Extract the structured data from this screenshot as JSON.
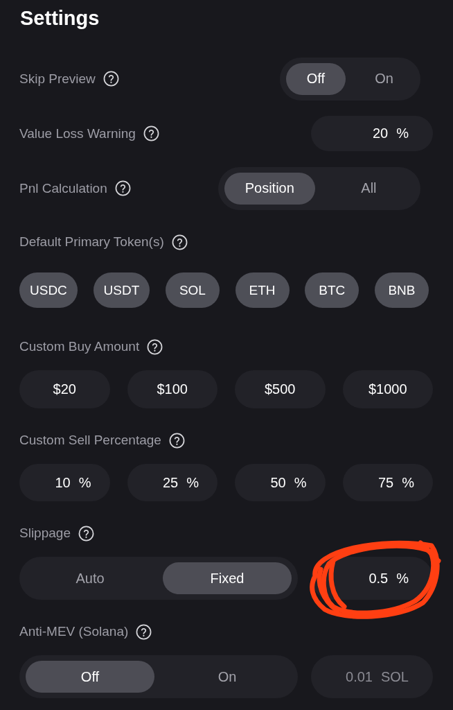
{
  "title": "Settings",
  "settings": [
    {
      "kind": "segmented",
      "label": "Skip Preview",
      "options": [
        {
          "label": "Off",
          "selected": true
        },
        {
          "label": "On",
          "selected": false
        }
      ]
    },
    {
      "kind": "input",
      "label": "Value Loss Warning",
      "field": {
        "value": "20",
        "unit": "%",
        "disabled": false
      }
    },
    {
      "kind": "segmented",
      "label": "Pnl Calculation",
      "options": [
        {
          "label": "Position",
          "selected": true
        },
        {
          "label": "All",
          "selected": false
        }
      ]
    },
    {
      "kind": "chips",
      "label": "Default Primary Token(s)",
      "chips": [
        {
          "label": "USDC",
          "selected": true
        },
        {
          "label": "USDT",
          "selected": true
        },
        {
          "label": "SOL",
          "selected": true
        },
        {
          "label": "ETH",
          "selected": true
        },
        {
          "label": "BTC",
          "selected": true
        },
        {
          "label": "BNB",
          "selected": true
        }
      ]
    },
    {
      "kind": "buttons",
      "label": "Custom Buy Amount",
      "buttons": [
        "$20",
        "$100",
        "$500",
        "$1000"
      ]
    },
    {
      "kind": "fields",
      "label": "Custom Sell Percentage",
      "fields": [
        {
          "value": "10",
          "unit": "%"
        },
        {
          "value": "25",
          "unit": "%"
        },
        {
          "value": "50",
          "unit": "%"
        },
        {
          "value": "75",
          "unit": "%"
        }
      ]
    },
    {
      "kind": "segmented_input",
      "label": "Slippage",
      "options": [
        {
          "label": "Auto",
          "selected": false
        },
        {
          "label": "Fixed",
          "selected": true
        }
      ],
      "field": {
        "value": "0.5",
        "unit": "%",
        "disabled": false,
        "circled": true
      }
    },
    {
      "kind": "segmented_input",
      "label": "Anti-MEV (Solana)",
      "options": [
        {
          "label": "Off",
          "selected": true
        },
        {
          "label": "On",
          "selected": false
        }
      ],
      "field": {
        "value": "0.01",
        "unit": "SOL",
        "disabled": true
      }
    }
  ]
}
